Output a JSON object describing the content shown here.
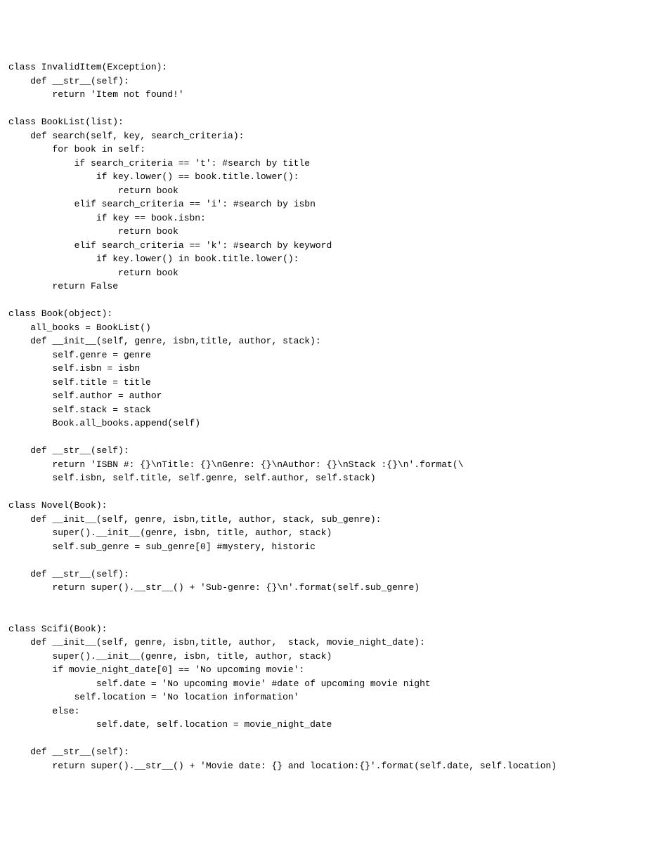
{
  "code_lines": [
    "class InvalidItem(Exception):",
    "    def __str__(self):",
    "        return 'Item not found!'",
    "",
    "class BookList(list):",
    "    def search(self, key, search_criteria):",
    "        for book in self:",
    "            if search_criteria == 't': #search by title",
    "                if key.lower() == book.title.lower():",
    "                    return book",
    "            elif search_criteria == 'i': #search by isbn",
    "                if key == book.isbn:",
    "                    return book",
    "            elif search_criteria == 'k': #search by keyword",
    "                if key.lower() in book.title.lower():",
    "                    return book",
    "        return False",
    "",
    "class Book(object):",
    "    all_books = BookList()",
    "    def __init__(self, genre, isbn,title, author, stack):",
    "        self.genre = genre",
    "        self.isbn = isbn",
    "        self.title = title",
    "        self.author = author",
    "        self.stack = stack",
    "        Book.all_books.append(self)",
    "",
    "    def __str__(self):",
    "        return 'ISBN #: {}\\nTitle: {}\\nGenre: {}\\nAuthor: {}\\nStack :{}\\n'.format(\\",
    "        self.isbn, self.title, self.genre, self.author, self.stack)",
    "",
    "class Novel(Book):",
    "    def __init__(self, genre, isbn,title, author, stack, sub_genre):",
    "        super().__init__(genre, isbn, title, author, stack)",
    "        self.sub_genre = sub_genre[0] #mystery, historic",
    "",
    "    def __str__(self):",
    "        return super().__str__() + 'Sub-genre: {}\\n'.format(self.sub_genre)",
    "",
    "",
    "class Scifi(Book):",
    "    def __init__(self, genre, isbn,title, author,  stack, movie_night_date):",
    "        super().__init__(genre, isbn, title, author, stack)",
    "        if movie_night_date[0] == 'No upcoming movie':",
    "                self.date = 'No upcoming movie' #date of upcoming movie night",
    "            self.location = 'No location information'",
    "        else:",
    "                self.date, self.location = movie_night_date",
    "",
    "    def __str__(self):",
    "        return super().__str__() + 'Movie date: {} and location:{}'.format(self.date, self.location)"
  ]
}
